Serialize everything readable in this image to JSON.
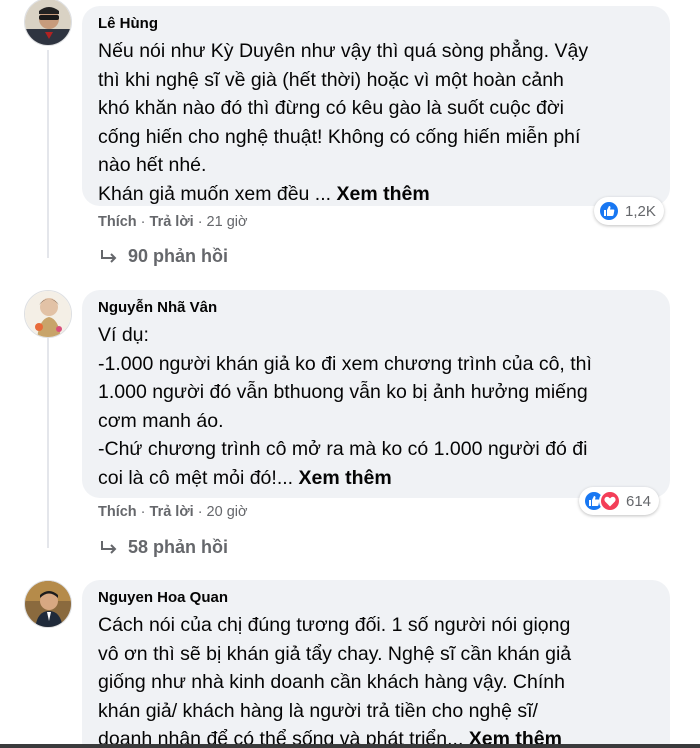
{
  "comments": [
    {
      "author": "Lê Hùng",
      "text": "Nếu nói như Kỳ Duyên như vậy thì quá sòng phẳng. Vậy\nthì khi nghệ sĩ về già (hết thời) hoặc vì một hoàn cảnh\nkhó khăn nào đó thì đừng có kêu gào là suốt cuộc đời\ncống hiến cho nghệ thuật! Không có cống hiến miễn phí\nnào hết nhé.\nKhán giả muốn xem đều ... ",
      "see_more": "Xem thêm",
      "like": "Thích",
      "reply": "Trả lời",
      "time": "21 giờ",
      "reaction_count": "1,2K",
      "reaction_icons": [
        "like-icon"
      ],
      "replies": "90 phản hồi"
    },
    {
      "author": "Nguyễn Nhã Vân",
      "text": "Ví dụ:\n-1.000 người khán giả ko đi xem chương trình của cô, thì\n1.000 người đó vẫn bthuong vẫn ko bị ảnh hưởng miếng\ncơm manh áo.\n-Chứ chương trình cô mở ra mà ko có 1.000 người đó đi\ncoi là cô mệt mỏi đó!... ",
      "see_more": "Xem thêm",
      "like": "Thích",
      "reply": "Trả lời",
      "time": "20 giờ",
      "reaction_count": "614",
      "reaction_icons": [
        "like-icon",
        "love-icon"
      ],
      "replies": "58 phản hồi"
    },
    {
      "author": "Nguyen Hoa Quan",
      "text": "Cách nói của chị đúng tương đối. 1 số người nói giọng\nvô ơn thì sẽ bị khán giả tẩy chay. Nghệ sĩ cần khán giả\ngiống như nhà kinh doanh cần khách hàng vậy. Chính\nkhán giả/ khách hàng là người trả tiền cho nghệ sĩ/\ndoanh nhân để có thể sống và phát triển... ",
      "see_more": "Xem thêm"
    }
  ],
  "separator": "·",
  "colors": {
    "bubble": "#f0f2f5",
    "secondary_text": "#65676b",
    "like_blue": "#1877f2",
    "love_red": "#f33e58"
  }
}
